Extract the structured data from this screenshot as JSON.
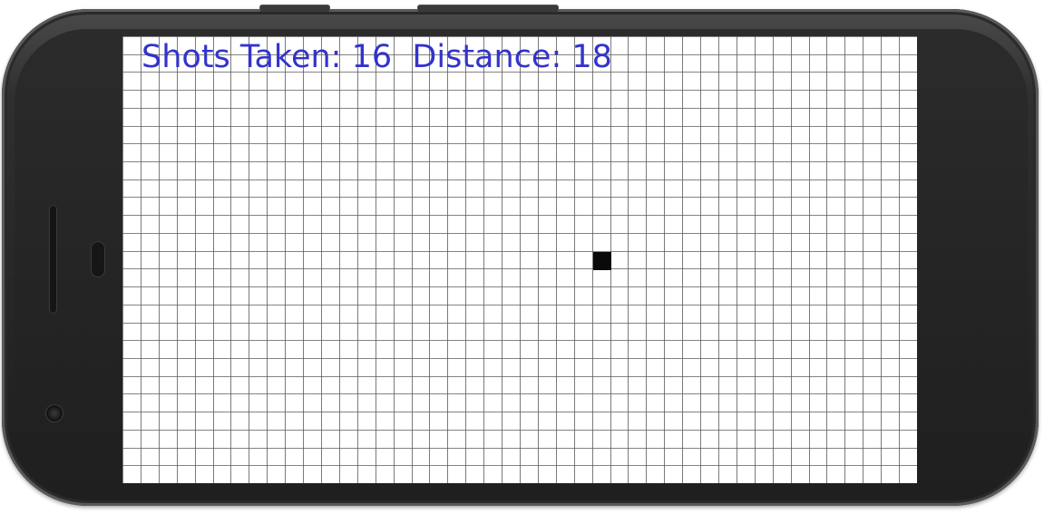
{
  "hud": {
    "shots_label": "Shots Taken:",
    "shots_value": "16",
    "distance_label": "Distance:",
    "distance_value": "18"
  },
  "game": {
    "grid": {
      "columns": 44,
      "rows": 25
    },
    "target_cell": {
      "column": 26,
      "row": 12
    },
    "colors": {
      "background": "#ffffff",
      "grid_line": "#5a5a5a",
      "hud_text": "#3333cc",
      "target": "#0a0a0a"
    }
  },
  "device": {
    "frame_color": "#2a2a2a"
  }
}
